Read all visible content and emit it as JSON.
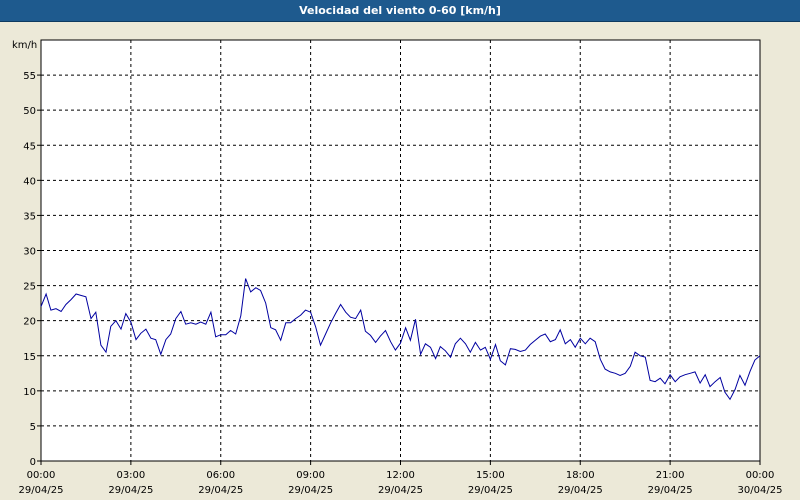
{
  "window": {
    "title": "Velocidad del viento 0-60 [km/h]"
  },
  "chart_data": {
    "type": "line",
    "title": "Velocidad del viento 0-60 [km/h]",
    "ylabel": "km/h",
    "ylim": [
      0,
      60
    ],
    "yticks": [
      0,
      5,
      10,
      15,
      20,
      25,
      30,
      35,
      40,
      45,
      50,
      55
    ],
    "xlim": [
      0,
      24
    ],
    "x_unit": "hours since 29/04/25 00:00",
    "xticks": [
      {
        "x": 0,
        "time": "00:00",
        "date": "29/04/25"
      },
      {
        "x": 3,
        "time": "03:00",
        "date": "29/04/25"
      },
      {
        "x": 6,
        "time": "06:00",
        "date": "29/04/25"
      },
      {
        "x": 9,
        "time": "09:00",
        "date": "29/04/25"
      },
      {
        "x": 12,
        "time": "12:00",
        "date": "29/04/25"
      },
      {
        "x": 15,
        "time": "15:00",
        "date": "29/04/25"
      },
      {
        "x": 18,
        "time": "18:00",
        "date": "29/04/25"
      },
      {
        "x": 21,
        "time": "21:00",
        "date": "29/04/25"
      },
      {
        "x": 24,
        "time": "00:00",
        "date": "30/04/25"
      }
    ],
    "grid": true,
    "series_color": "#0000a0",
    "series": [
      {
        "x": [
          0.0,
          0.17,
          0.33,
          0.5,
          0.67,
          0.83,
          1.0,
          1.17,
          1.33,
          1.5,
          1.67,
          1.83,
          2.0,
          2.17,
          2.33,
          2.5,
          2.67,
          2.83,
          3.0,
          3.17,
          3.33,
          3.5,
          3.67,
          3.83,
          4.0,
          4.17,
          4.33,
          4.5,
          4.67,
          4.83,
          5.0,
          5.17,
          5.33,
          5.5,
          5.67,
          5.83,
          6.0,
          6.17,
          6.33,
          6.5,
          6.67,
          6.83,
          7.0,
          7.17,
          7.33,
          7.5,
          7.67,
          7.83,
          8.0,
          8.17,
          8.33,
          8.5,
          8.67,
          8.83,
          9.0,
          9.17,
          9.33,
          9.5,
          9.67,
          9.83,
          10.0,
          10.17,
          10.33,
          10.5,
          10.67,
          10.83,
          11.0,
          11.17,
          11.33,
          11.5,
          11.67,
          11.83,
          12.0,
          12.17,
          12.33,
          12.5,
          12.67,
          12.83,
          13.0,
          13.17,
          13.33,
          13.5,
          13.67,
          13.83,
          14.0,
          14.17,
          14.33,
          14.5,
          14.67,
          14.83,
          15.0,
          15.17,
          15.33,
          15.5,
          15.67,
          15.83,
          16.0,
          16.17,
          16.33,
          16.5,
          16.67,
          16.83,
          17.0,
          17.17,
          17.33,
          17.5,
          17.67,
          17.83,
          18.0,
          18.17,
          18.33,
          18.5,
          18.67,
          18.83,
          19.0,
          19.17,
          19.33,
          19.5,
          19.67,
          19.83,
          20.0,
          20.17,
          20.33,
          20.5,
          20.67,
          20.83,
          21.0,
          21.17,
          21.33,
          21.5,
          21.67,
          21.83,
          22.0,
          22.17,
          22.33,
          22.5,
          22.67,
          22.83,
          23.0,
          23.17,
          23.33,
          23.5,
          23.67,
          23.83,
          24.0
        ],
        "values": [
          22.0,
          23.8,
          21.5,
          21.7,
          21.3,
          22.3,
          23.0,
          23.8,
          23.6,
          23.4,
          20.3,
          21.2,
          16.5,
          15.5,
          19.2,
          20.0,
          18.8,
          21.0,
          19.8,
          17.3,
          18.2,
          18.8,
          17.5,
          17.3,
          15.2,
          17.3,
          18.1,
          20.3,
          21.3,
          19.5,
          19.7,
          19.5,
          19.8,
          19.5,
          21.2,
          17.7,
          18.0,
          18.0,
          18.6,
          18.1,
          20.7,
          26.0,
          24.1,
          24.7,
          24.3,
          22.5,
          19.0,
          18.7,
          17.2,
          19.7,
          19.7,
          20.3,
          20.8,
          21.5,
          21.2,
          19.1,
          16.5,
          18.1,
          19.7,
          21.0,
          22.3,
          21.2,
          20.5,
          20.3,
          21.5,
          18.5,
          17.9,
          16.9,
          17.8,
          18.6,
          17.0,
          15.8,
          16.8,
          19.0,
          17.2,
          20.2,
          15.2,
          16.7,
          16.2,
          14.6,
          16.3,
          15.7,
          14.8,
          16.7,
          17.5,
          16.7,
          15.5,
          16.9,
          15.8,
          16.2,
          14.5,
          16.6,
          14.3,
          13.7,
          16.0,
          15.9,
          15.6,
          15.8,
          16.6,
          17.2,
          17.8,
          18.1,
          17.0,
          17.3,
          18.7,
          16.7,
          17.3,
          16.2,
          17.5,
          16.7,
          17.5,
          17.0,
          14.5,
          13.1,
          12.7,
          12.5,
          12.2,
          12.5,
          13.5,
          15.5,
          15.0,
          14.8,
          11.5,
          11.3,
          11.8,
          11.0,
          12.3,
          11.3,
          12.0,
          12.3,
          12.5,
          12.7,
          11.1,
          12.3,
          10.6,
          11.3,
          11.9,
          9.8,
          8.8,
          10.2,
          12.2,
          10.8,
          12.8,
          14.4,
          15.0
        ]
      }
    ]
  }
}
